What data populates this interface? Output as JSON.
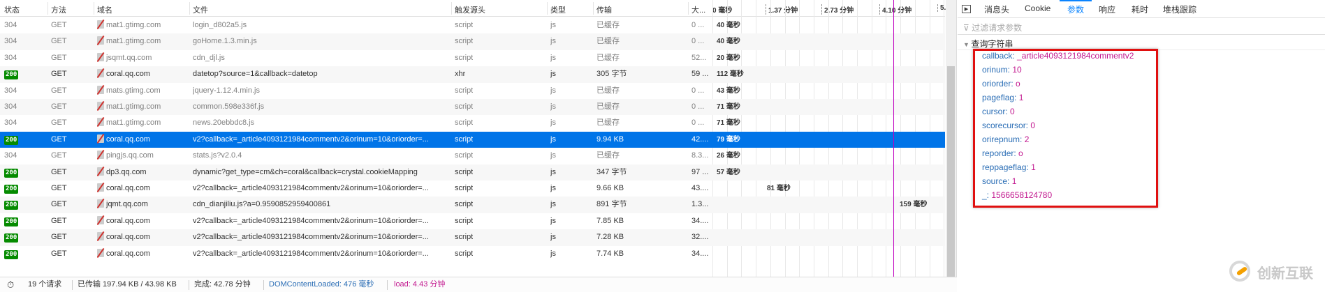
{
  "columns": {
    "status": "状态",
    "method": "方法",
    "domain": "域名",
    "file": "文件",
    "cause": "触发源头",
    "type": "类型",
    "transferred": "传输",
    "size": "大...",
    "timeline": "0 毫秒"
  },
  "timeline_ticks": [
    "1.37 分钟",
    "2.73 分钟",
    "4.10 分钟",
    "5."
  ],
  "requests": [
    {
      "status": "304",
      "method": "GET",
      "domain": "mat1.gtimg.com",
      "file": "login_d802a5.js",
      "cause": "script",
      "type": "js",
      "transferred": "已缓存",
      "size": "0 ...",
      "time": "40 毫秒"
    },
    {
      "status": "304",
      "method": "GET",
      "domain": "mat1.gtimg.com",
      "file": "goHome.1.3.min.js",
      "cause": "script",
      "type": "js",
      "transferred": "已缓存",
      "size": "0 ...",
      "time": "40 毫秒"
    },
    {
      "status": "304",
      "method": "GET",
      "domain": "jsqmt.qq.com",
      "file": "cdn_djl.js",
      "cause": "script",
      "type": "js",
      "transferred": "已缓存",
      "size": "52...",
      "time": "20 毫秒"
    },
    {
      "status": "200",
      "method": "GET",
      "domain": "coral.qq.com",
      "file": "datetop?source=1&callback=datetop",
      "cause": "xhr",
      "type": "js",
      "transferred": "305 字节",
      "size": "59 ...",
      "time": "112 毫秒"
    },
    {
      "status": "304",
      "method": "GET",
      "domain": "mats.gtimg.com",
      "file": "jquery-1.12.4.min.js",
      "cause": "script",
      "type": "js",
      "transferred": "已缓存",
      "size": "0 ...",
      "time": "43 毫秒"
    },
    {
      "status": "304",
      "method": "GET",
      "domain": "mat1.gtimg.com",
      "file": "common.598e336f.js",
      "cause": "script",
      "type": "js",
      "transferred": "已缓存",
      "size": "0 ...",
      "time": "71 毫秒"
    },
    {
      "status": "304",
      "method": "GET",
      "domain": "mat1.gtimg.com",
      "file": "news.20ebbdc8.js",
      "cause": "script",
      "type": "js",
      "transferred": "已缓存",
      "size": "0 ...",
      "time": "71 毫秒"
    },
    {
      "status": "200",
      "method": "GET",
      "domain": "coral.qq.com",
      "file": "v2?callback=_article4093121984commentv2&orinum=10&oriorder=...",
      "cause": "script",
      "type": "js",
      "transferred": "9.94 KB",
      "size": "42....",
      "time": "79 毫秒",
      "selected": true
    },
    {
      "status": "304",
      "method": "GET",
      "domain": "pingjs.qq.com",
      "file": "stats.js?v2.0.4",
      "cause": "script",
      "type": "js",
      "transferred": "已缓存",
      "size": "8.3...",
      "time": "26 毫秒"
    },
    {
      "status": "200",
      "method": "GET",
      "domain": "dp3.qq.com",
      "file": "dynamic?get_type=cm&ch=coral&callback=crystal.cookieMapping",
      "cause": "script",
      "type": "js",
      "transferred": "347 字节",
      "size": "97 ...",
      "time": "57 毫秒"
    },
    {
      "status": "200",
      "method": "GET",
      "domain": "coral.qq.com",
      "file": "v2?callback=_article4093121984commentv2&orinum=10&oriorder=...",
      "cause": "script",
      "type": "js",
      "transferred": "9.66 KB",
      "size": "43....",
      "time": "81 毫秒",
      "time_offset": 0.22
    },
    {
      "status": "200",
      "method": "GET",
      "domain": "jqmt.qq.com",
      "file": "cdn_dianjiliu.js?a=0.9590852959400861",
      "cause": "script",
      "type": "js",
      "transferred": "891 字节",
      "size": "1.3...",
      "time": "159 毫秒",
      "time_offset": 0.8
    },
    {
      "status": "200",
      "method": "GET",
      "domain": "coral.qq.com",
      "file": "v2?callback=_article4093121984commentv2&orinum=10&oriorder=...",
      "cause": "script",
      "type": "js",
      "transferred": "7.85 KB",
      "size": "34...."
    },
    {
      "status": "200",
      "method": "GET",
      "domain": "coral.qq.com",
      "file": "v2?callback=_article4093121984commentv2&orinum=10&oriorder=...",
      "cause": "script",
      "type": "js",
      "transferred": "7.28 KB",
      "size": "32...."
    },
    {
      "status": "200",
      "method": "GET",
      "domain": "coral.qq.com",
      "file": "v2?callback=_article4093121984commentv2&orinum=10&oriorder=...",
      "cause": "script",
      "type": "js",
      "transferred": "7.74 KB",
      "size": "34...."
    }
  ],
  "footer": {
    "requests": "19 个请求",
    "transferred": "已传输 197.94 KB / 43.98 KB",
    "finish": "完成: 42.78 分钟",
    "dcl": "DOMContentLoaded: 476 毫秒",
    "load": "load: 4.43 分钟"
  },
  "details": {
    "tabs": [
      "消息头",
      "Cookie",
      "参数",
      "响应",
      "耗时",
      "堆栈跟踪"
    ],
    "active_tab": "参数",
    "filter_placeholder": "过滤请求参数",
    "section": "查询字符串",
    "params": [
      {
        "key": "callback:",
        "value": "_article4093121984commentv2"
      },
      {
        "key": "orinum:",
        "value": "10"
      },
      {
        "key": "oriorder:",
        "value": "o"
      },
      {
        "key": "pageflag:",
        "value": "1"
      },
      {
        "key": "cursor:",
        "value": "0"
      },
      {
        "key": "scorecursor:",
        "value": "0"
      },
      {
        "key": "orirepnum:",
        "value": "2"
      },
      {
        "key": "reporder:",
        "value": "o"
      },
      {
        "key": "reppageflag:",
        "value": "1"
      },
      {
        "key": "source:",
        "value": "1"
      },
      {
        "key": "_:",
        "value": "1566658124780"
      }
    ]
  },
  "watermark": "创新互联",
  "colors": {
    "selected": "#0074e8",
    "ok_badge": "#058b00",
    "highlight_box": "#e01010",
    "load_line": "#c000c0"
  }
}
